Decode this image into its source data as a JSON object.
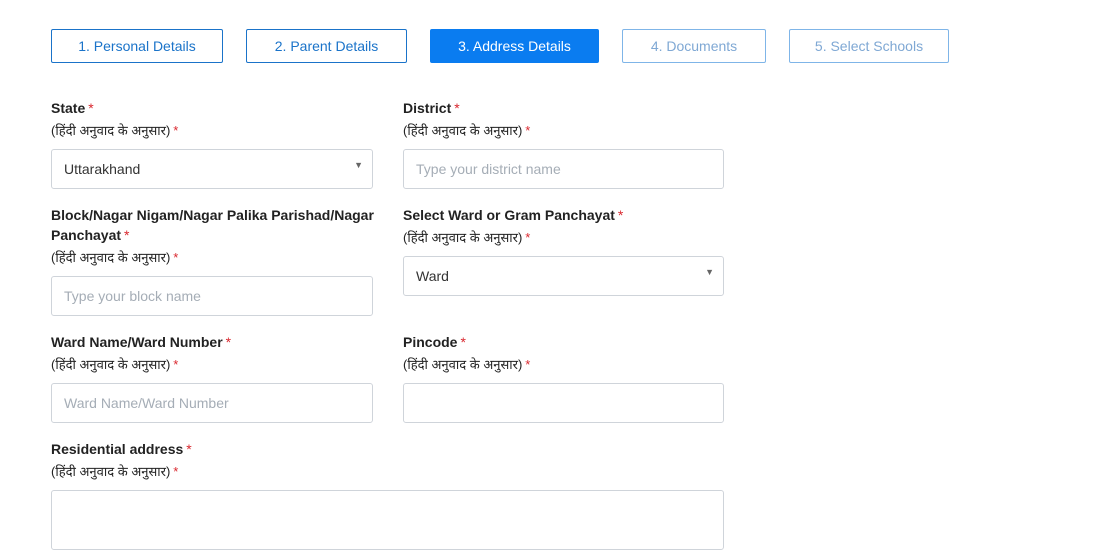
{
  "steps": [
    {
      "label": "1. Personal Details"
    },
    {
      "label": "2. Parent Details"
    },
    {
      "label": "3. Address Details"
    },
    {
      "label": "4. Documents"
    },
    {
      "label": "5. Select Schools"
    }
  ],
  "hindi_note": "(हिंदी अनुवाद के अनुसार)",
  "required_mark": "*",
  "fields": {
    "state": {
      "label": "State",
      "value": "Uttarakhand"
    },
    "district": {
      "label": "District",
      "placeholder": "Type your district name"
    },
    "block": {
      "label": "Block/Nagar Nigam/Nagar Palika Parishad/Nagar Panchayat",
      "placeholder": "Type your block name"
    },
    "ward_type": {
      "label": "Select Ward or Gram Panchayat",
      "value": "Ward"
    },
    "ward_name": {
      "label": "Ward Name/Ward Number",
      "placeholder": "Ward Name/Ward Number"
    },
    "pincode": {
      "label": "Pincode",
      "value": ""
    },
    "address": {
      "label": "Residential address",
      "value": ""
    }
  },
  "icons": {
    "dropdown": "caret-down-icon"
  }
}
